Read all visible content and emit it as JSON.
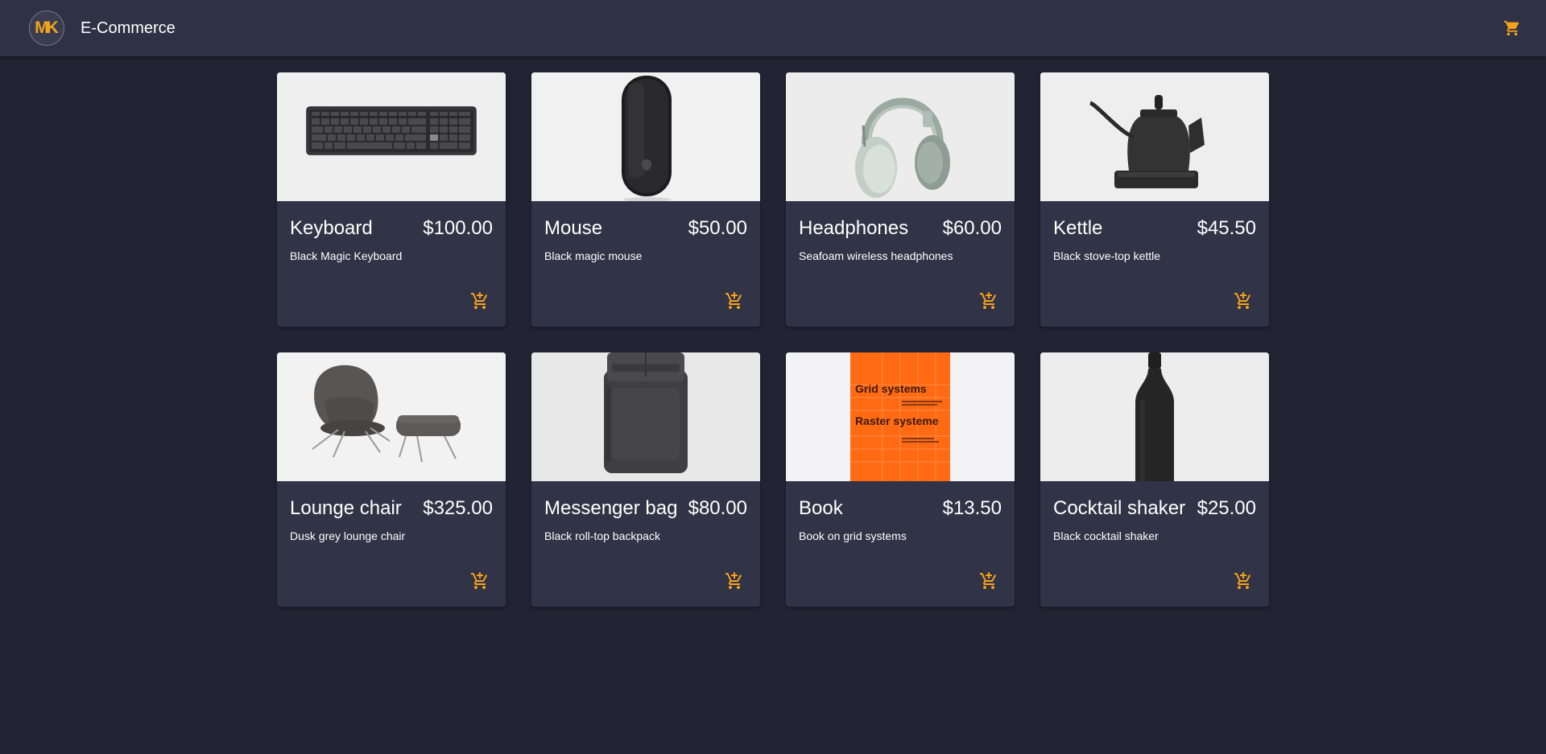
{
  "header": {
    "logo_text": "MK",
    "title": "E-Commerce",
    "cart_icon": "cart-icon"
  },
  "colors": {
    "accent": "#f7a21b",
    "background": "#222433",
    "surface": "#313346",
    "toolbar": "#2f3145"
  },
  "products": [
    {
      "name": "Keyboard",
      "price": "$100.00",
      "description": "Black Magic Keyboard",
      "image": "keyboard-image"
    },
    {
      "name": "Mouse",
      "price": "$50.00",
      "description": "Black magic mouse",
      "image": "mouse-image"
    },
    {
      "name": "Headphones",
      "price": "$60.00",
      "description": "Seafoam wireless headphones",
      "image": "headphones-image"
    },
    {
      "name": "Kettle",
      "price": "$45.50",
      "description": "Black stove-top kettle",
      "image": "kettle-image"
    },
    {
      "name": "Lounge chair",
      "price": "$325.00",
      "description": "Dusk grey lounge chair",
      "image": "lounge-chair-image"
    },
    {
      "name": "Messenger bag",
      "price": "$80.00",
      "description": "Black roll-top backpack",
      "image": "backpack-image"
    },
    {
      "name": "Book",
      "price": "$13.50",
      "description": "Book on grid systems",
      "image": "book-image",
      "cover_title_1": "Grid systems",
      "cover_title_2": "Raster systeme"
    },
    {
      "name": "Cocktail shaker",
      "price": "$25.00",
      "description": "Black cocktail shaker",
      "image": "cocktail-shaker-image"
    }
  ]
}
